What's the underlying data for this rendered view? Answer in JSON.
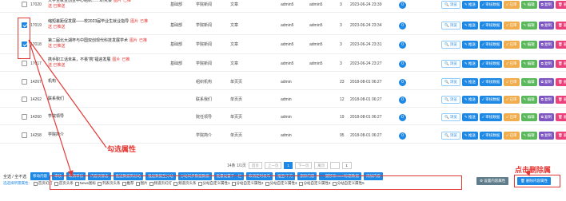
{
  "table": {
    "rows": [
      {
        "id": "17020",
        "title": "大学生就业创业中心组织……研究会",
        "flag1": "图片",
        "flag2": "已推",
        "flag3": "送 已推送",
        "site": "基础部",
        "column": "学院新闻",
        "type": "文章",
        "author": "admin5",
        "editor": "admin5",
        "count": "3",
        "date": "2023-06-24 23:39",
        "zero": "0",
        "checked": false
      },
      {
        "id": "17019",
        "title": "缩短差距促发展——校2023届毕业生就业指导",
        "flag1": "图片",
        "flag2": "已推",
        "flag3": "送 已推送",
        "site": "基础部",
        "column": "学院新闻",
        "type": "文章",
        "author": "admin5",
        "editor": "admin5",
        "count": "3",
        "date": "2023-06-24 23:34",
        "zero": "0",
        "checked": true
      },
      {
        "id": "17018",
        "title": "第二届北大湖杯与中国双创现代科技发展学术",
        "flag1": "图片",
        "flag2": "已推",
        "flag3": "送 已推送",
        "site": "基础部",
        "column": "学院新闻",
        "type": "文章",
        "author": "admin5",
        "editor": "admin5",
        "count": "3",
        "date": "2023-06-24 23:31",
        "zero": "0",
        "checked": true
      },
      {
        "id": "17017",
        "title": "携手职工话未来，不畏“携”福迎发展",
        "flag1": "图片",
        "flag2": "已推",
        "flag3": "送 已推送",
        "site": "基础部",
        "column": "学院新闻",
        "type": "文章",
        "author": "admin5",
        "editor": "admin5",
        "count": "3",
        "date": "2023-06-24 23:27",
        "zero": "0",
        "checked": false
      },
      {
        "id": "14267",
        "title": "机构",
        "flag1": "",
        "flag2": "",
        "flag3": "",
        "site": "",
        "column": "组织机构",
        "type": "单页页",
        "author": "admin",
        "editor": "",
        "count": "23",
        "date": "2018-08-01 06:27",
        "zero": "0",
        "checked": false
      },
      {
        "id": "14262",
        "title": "联系我们",
        "flag1": "",
        "flag2": "",
        "flag3": "",
        "site": "",
        "column": "联系我们",
        "type": "单页页",
        "author": "admin",
        "editor": "",
        "count": "12",
        "date": "2018-08-01 06:27",
        "zero": "0",
        "checked": false
      },
      {
        "id": "14260",
        "title": "学院领导",
        "flag1": "",
        "flag2": "",
        "flag3": "",
        "site": "",
        "column": "院任领导",
        "type": "单页页",
        "author": "admin",
        "editor": "",
        "count": "19",
        "date": "2018-08-01 06:27",
        "zero": "0",
        "checked": false
      },
      {
        "id": "14258",
        "title": "学院简介",
        "flag1": "",
        "flag2": "",
        "flag3": "",
        "site": "",
        "column": "学院简介",
        "type": "单页页",
        "author": "admin",
        "editor": "",
        "count": "95",
        "date": "2018-08-01 06:27",
        "zero": "0",
        "checked": false
      }
    ],
    "actions": [
      {
        "label": "🔍 浏览",
        "style": "b-gray"
      },
      {
        "label": "✎ 推送",
        "style": "b-blue"
      },
      {
        "label": "✓ 审核数据",
        "style": "b-blue"
      },
      {
        "label": "✓ 已审",
        "style": "b-orange"
      },
      {
        "label": "✎ 编辑",
        "style": "b-green"
      },
      {
        "label": "⧉ 复制",
        "style": "b-purple"
      },
      {
        "label": "🗑 删除",
        "style": "b-pink"
      }
    ]
  },
  "pager": {
    "summary": "14条 1/1页",
    "first": "首页",
    "prev": "上一页",
    "current": "1",
    "next": "下一页",
    "last": "尾页",
    "jump_value": "1",
    "total": "1"
  },
  "bulk": {
    "select_label": "全选 / 全不选",
    "buttons": [
      "移动内容",
      "审核",
      "取消审核",
      "内容页静态",
      "推送数据到总站",
      "推送数据至分站",
      "分站同步数据数据",
      "批量设置下一栏",
      "取消定时发布",
      "推至/下方",
      "删除内容",
      "一键移除excel标题数据",
      "添加内容"
    ]
  },
  "attributes": {
    "label": "选选择所需属性:",
    "items": [
      "首页幻灯",
      "首页头条",
      "News图标",
      "列表页头条",
      "推荐",
      "图片",
      "频道页幻灯",
      "频道页头条",
      "分站自定义属性1",
      "分站自定义属性2",
      "分站自定义属性3",
      "分站自定义属性4",
      "分站自定义属性5"
    ],
    "set_button": "⚙ 设置内容属性",
    "delete_button": "🗑 删除内容属性"
  },
  "annotations": {
    "select_attr": "勾选属性",
    "click_delete": "点击删除属"
  },
  "colors": {
    "accent": "#1e88e5",
    "annotation": "#e53935"
  }
}
